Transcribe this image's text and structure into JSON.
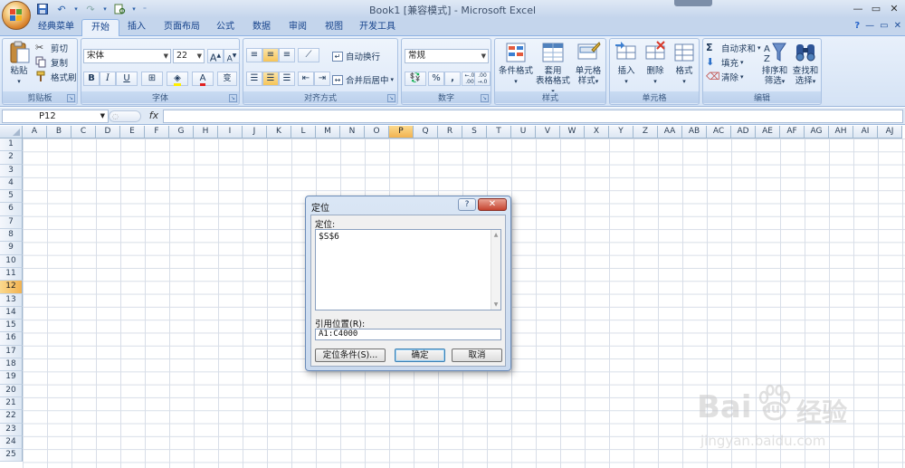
{
  "app": {
    "title": "Book1  [兼容模式] - Microsoft Excel"
  },
  "quick_access": {
    "save_icon": "save-icon",
    "undo_icon": "undo-icon",
    "redo_icon": "redo-icon",
    "customize_icon": "customize-icon"
  },
  "window_controls": {
    "minimize": "—",
    "maximize": "▭",
    "close": "✕"
  },
  "ribbon_tabs": [
    {
      "label": "经典菜单",
      "active": false
    },
    {
      "label": "开始",
      "active": true
    },
    {
      "label": "插入",
      "active": false
    },
    {
      "label": "页面布局",
      "active": false
    },
    {
      "label": "公式",
      "active": false
    },
    {
      "label": "数据",
      "active": false
    },
    {
      "label": "审阅",
      "active": false
    },
    {
      "label": "视图",
      "active": false
    },
    {
      "label": "开发工具",
      "active": false
    }
  ],
  "clipboard": {
    "label": "剪贴板",
    "paste": "粘贴",
    "cut": "剪切",
    "copy": "复制",
    "format_painter": "格式刷"
  },
  "font": {
    "label": "字体",
    "name": "宋体",
    "size": "22",
    "grow": "A",
    "shrink": "A",
    "bold": "B",
    "italic": "I",
    "underline": "U",
    "font_color": "A",
    "phonetic": "变"
  },
  "alignment": {
    "label": "对齐方式",
    "wrap_text": "自动换行",
    "merge_center": "合并后居中"
  },
  "number": {
    "label": "数字",
    "format": "常规",
    "percent": "%",
    "comma": ",",
    "inc_decimal": ".0​.00",
    "dec_decimal": ".00​.0"
  },
  "styles": {
    "label": "样式",
    "conditional": "条件格式",
    "table_format_1": "套用",
    "table_format_2": "表格格式",
    "cell_styles_1": "单元格",
    "cell_styles_2": "样式"
  },
  "cells": {
    "label": "单元格",
    "insert": "插入",
    "delete": "删除",
    "format": "格式"
  },
  "editing": {
    "label": "编辑",
    "autosum": "自动求和",
    "fill": "填充",
    "clear": "清除",
    "sort_filter_1": "排序和",
    "sort_filter_2": "筛选",
    "find_select_1": "查找和",
    "find_select_2": "选择"
  },
  "formula_bar": {
    "name_box": "P12",
    "fx": "fx",
    "content": ""
  },
  "sheet": {
    "columns": [
      "A",
      "B",
      "C",
      "D",
      "E",
      "F",
      "G",
      "H",
      "I",
      "J",
      "K",
      "L",
      "M",
      "N",
      "O",
      "P",
      "Q",
      "R",
      "S",
      "T",
      "U",
      "V",
      "W",
      "X",
      "Y",
      "Z",
      "AA",
      "AB",
      "AC",
      "AD",
      "AE",
      "AF",
      "AG",
      "AH",
      "AI",
      "AJ"
    ],
    "rows": [
      "1",
      "2",
      "3",
      "4",
      "5",
      "6",
      "7",
      "8",
      "9",
      "10",
      "11",
      "12",
      "13",
      "14",
      "15",
      "16",
      "17",
      "18",
      "19",
      "20",
      "21",
      "22",
      "23",
      "24",
      "25"
    ],
    "selected_column": "P",
    "selected_row": "12"
  },
  "goto_dialog": {
    "title": "定位",
    "help": "?",
    "close": "✕",
    "goto_label": "定位:",
    "list_items": [
      "$S$6"
    ],
    "reference_label": "引用位置(R):",
    "reference_value": "A1:C4000",
    "special_button": "定位条件(S)...",
    "ok_button": "确定",
    "cancel_button": "取消"
  },
  "watermark": {
    "brand": "Bai",
    "brand_suffix": "经验",
    "du": "du",
    "url": "jingyan.baidu.com"
  },
  "colors": {
    "ribbon_bg": "#dce8f8",
    "tab_text": "#15428b",
    "selected_header": "#f2b250",
    "dialog_close": "#c5432f"
  }
}
